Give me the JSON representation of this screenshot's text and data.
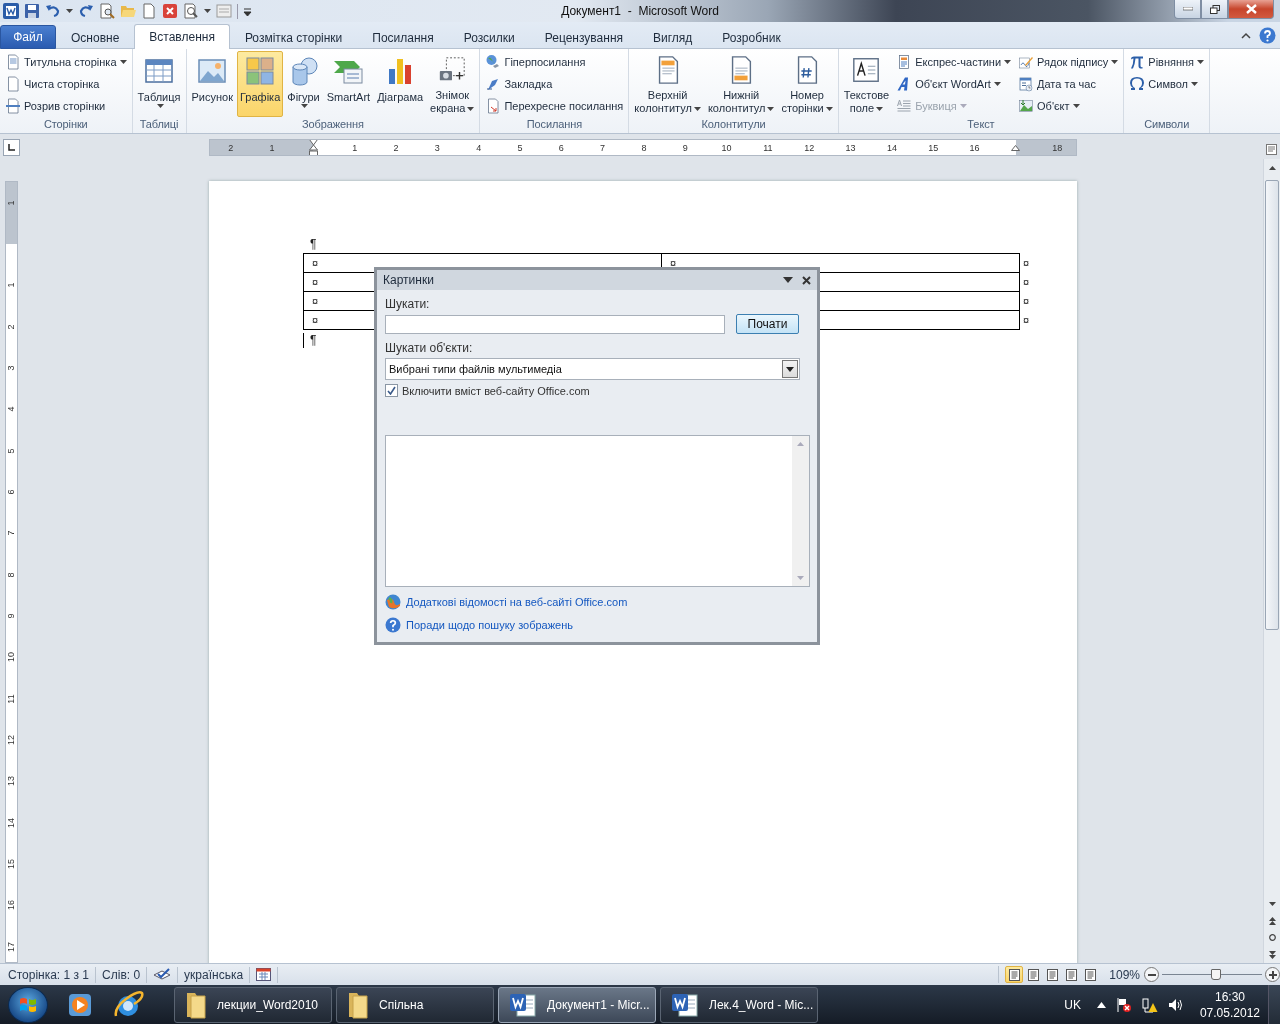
{
  "title_bar": {
    "title": "Документ1  -  Microsoft Word"
  },
  "ribbon_tabs": [
    {
      "label": "Файл",
      "kind": "file",
      "selected": false
    },
    {
      "label": "Основне",
      "kind": "tab",
      "selected": false
    },
    {
      "label": "Вставлення",
      "kind": "tab",
      "selected": true
    },
    {
      "label": "Розмітка сторінки",
      "kind": "tab",
      "selected": false
    },
    {
      "label": "Посилання",
      "kind": "tab",
      "selected": false
    },
    {
      "label": "Розсилки",
      "kind": "tab",
      "selected": false
    },
    {
      "label": "Рецензування",
      "kind": "tab",
      "selected": false
    },
    {
      "label": "Вигляд",
      "kind": "tab",
      "selected": false
    },
    {
      "label": "Розробник",
      "kind": "tab",
      "selected": false
    }
  ],
  "ribbon_groups": [
    {
      "label": "Сторінки",
      "items": [
        {
          "kind": "small",
          "label": "Титульна сторінка",
          "dropdown": true,
          "on": false,
          "disabled": false
        },
        {
          "kind": "small",
          "label": "Чиста сторінка",
          "dropdown": false,
          "on": false,
          "disabled": false
        },
        {
          "kind": "small",
          "label": "Розрив сторінки",
          "dropdown": false,
          "on": false,
          "disabled": false
        }
      ]
    },
    {
      "label": "Таблиці",
      "items": [
        {
          "kind": "large",
          "label": "Таблиця",
          "dropdown": true,
          "on": false,
          "disabled": false
        }
      ]
    },
    {
      "label": "Зображення",
      "items": [
        {
          "kind": "large",
          "label": "Рисунок",
          "dropdown": false,
          "on": false,
          "disabled": false
        },
        {
          "kind": "large",
          "label": "Графіка",
          "dropdown": false,
          "on": true,
          "disabled": false
        },
        {
          "kind": "large",
          "label": "Фігури",
          "dropdown": true,
          "on": false,
          "disabled": false
        },
        {
          "kind": "large",
          "label": "SmartArt",
          "dropdown": false,
          "on": false,
          "disabled": false
        },
        {
          "kind": "large",
          "label": "Діаграма",
          "dropdown": false,
          "on": false,
          "disabled": false
        },
        {
          "kind": "large",
          "label": "Знімок\nекрана",
          "dropdown": true,
          "on": false,
          "disabled": false
        }
      ]
    },
    {
      "label": "Посилання",
      "items": [
        {
          "kind": "small",
          "label": "Гіперпосилання",
          "dropdown": false,
          "on": false,
          "disabled": false
        },
        {
          "kind": "small",
          "label": "Закладка",
          "dropdown": false,
          "on": false,
          "disabled": false
        },
        {
          "kind": "small",
          "label": "Перехресне посилання",
          "dropdown": false,
          "on": false,
          "disabled": false
        }
      ]
    },
    {
      "label": "Колонтитули",
      "items": [
        {
          "kind": "large",
          "label": "Верхній\nколонтитул",
          "dropdown": true,
          "on": false,
          "disabled": false
        },
        {
          "kind": "large",
          "label": "Нижній\nколонтитул",
          "dropdown": true,
          "on": false,
          "disabled": false
        },
        {
          "kind": "large",
          "label": "Номер\nсторінки",
          "dropdown": true,
          "on": false,
          "disabled": false
        }
      ]
    },
    {
      "label": "Текст",
      "items": [
        {
          "kind": "large",
          "label": "Текстове\nполе",
          "dropdown": true,
          "on": false,
          "disabled": false
        },
        {
          "kind": "small",
          "label": "Експрес-частини",
          "dropdown": true,
          "on": false,
          "disabled": false
        },
        {
          "kind": "small",
          "label": "Об'єкт WordArt",
          "dropdown": true,
          "on": false,
          "disabled": false
        },
        {
          "kind": "small",
          "label": "Буквиця",
          "dropdown": true,
          "on": false,
          "disabled": true
        },
        {
          "kind": "small",
          "label": "Рядок підпису",
          "dropdown": true,
          "on": false,
          "disabled": false
        },
        {
          "kind": "small",
          "label": "Дата та час",
          "dropdown": false,
          "on": false,
          "disabled": false
        },
        {
          "kind": "small",
          "label": "Об'єкт",
          "dropdown": true,
          "on": false,
          "disabled": false
        }
      ]
    },
    {
      "label": "Символи",
      "items": [
        {
          "kind": "small",
          "label": "Рівняння",
          "dropdown": true,
          "on": false,
          "disabled": false
        },
        {
          "kind": "small",
          "label": "Символ",
          "dropdown": true,
          "on": false,
          "disabled": false
        }
      ]
    }
  ],
  "ruler": {
    "left_margin_marks": [
      "2",
      "1"
    ],
    "text_marks": [
      "1",
      "2",
      "3",
      "4",
      "5",
      "6",
      "7",
      "8",
      "9",
      "10",
      "11",
      "12",
      "13",
      "14",
      "15",
      "16"
    ],
    "right_margin_marks": [
      "18"
    ]
  },
  "vertical_ruler": {
    "top_margin_marks": [
      "1"
    ],
    "text_marks": [
      "1",
      "2",
      "3",
      "4",
      "5",
      "6",
      "7",
      "8",
      "9",
      "10",
      "11",
      "12",
      "13",
      "14",
      "15",
      "16",
      "17"
    ]
  },
  "document": {
    "mark_before": "¶",
    "table_rows": [
      {
        "cells": [
          "¤",
          "¤"
        ],
        "end": "¤"
      },
      {
        "cells": [
          "¤"
        ],
        "end": "¤"
      },
      {
        "cells": [
          "¤"
        ],
        "end": "¤"
      },
      {
        "cells": [
          "¤"
        ],
        "end": "¤"
      }
    ],
    "mark_after": "¶"
  },
  "clip_art_pane": {
    "title": "Картинки",
    "search_label": "Шукати:",
    "go_button": "Почати",
    "types_label": "Шукати об'єкти:",
    "types_select": "Вибрані типи файлів мультимедіа",
    "include_office_com": {
      "label": "Включити вміст веб-сайту Office.com",
      "checked": true
    },
    "links": [
      "Додаткові відомості на веб-сайті Office.com",
      "Поради щодо пошуку зображень"
    ]
  },
  "status_bar": {
    "page": "Сторінка: 1 з 1",
    "words": "Слів: 0",
    "language": "українська",
    "views": [
      {
        "selected": true
      },
      {
        "selected": false
      },
      {
        "selected": false
      },
      {
        "selected": false
      },
      {
        "selected": false
      }
    ],
    "zoom": "109%",
    "zoom_slider": {
      "level": 0.54
    }
  },
  "taskbar": {
    "buttons": [
      {
        "label": "лекции_Word2010",
        "kind": "folder",
        "selected": false
      },
      {
        "label": "Спільна",
        "kind": "folder",
        "selected": false
      },
      {
        "label": "Документ1 - Micr...",
        "kind": "word",
        "selected": true
      },
      {
        "label": "Лек.4_Word - Mic...",
        "kind": "word",
        "selected": false
      }
    ],
    "language": "UK",
    "time": "16:30",
    "date": "07.05.2012"
  }
}
